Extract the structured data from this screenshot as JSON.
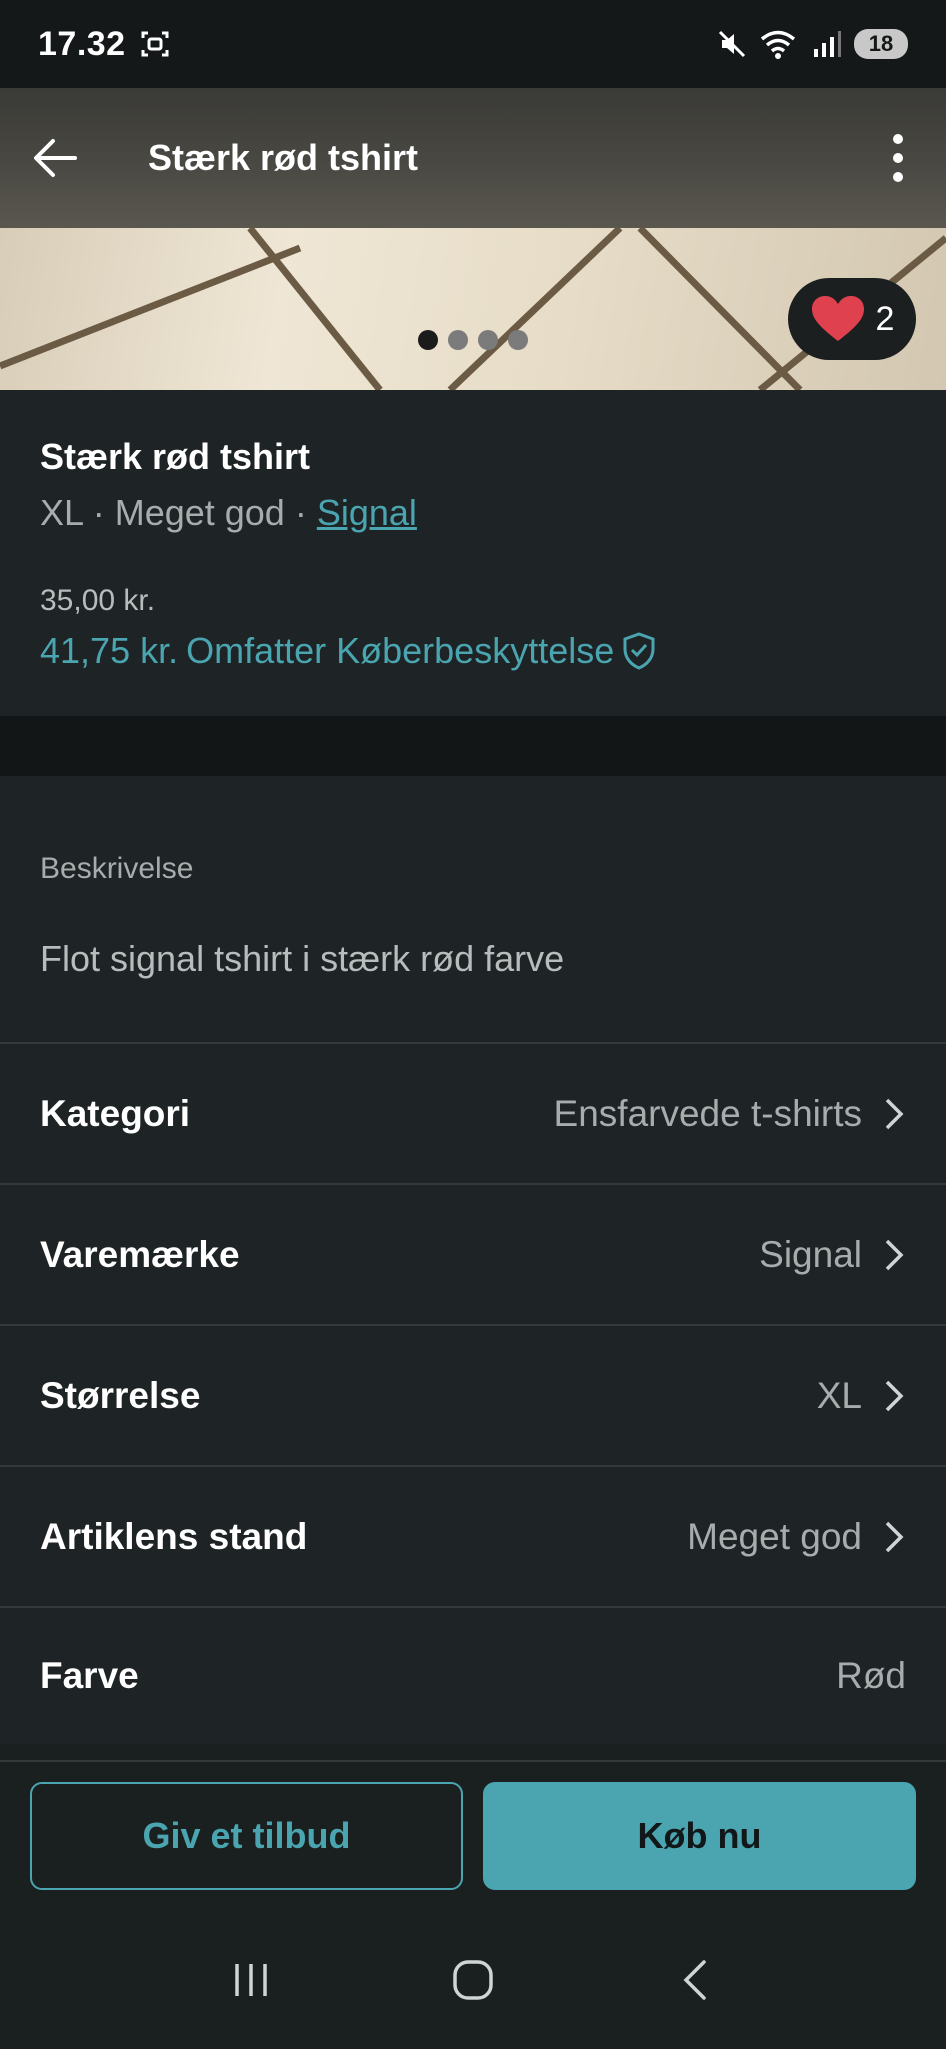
{
  "status_bar": {
    "time": "17.32",
    "battery": "18"
  },
  "app_bar": {
    "title": "Stærk rød tshirt"
  },
  "gallery": {
    "image_count": 4,
    "active_index": 0,
    "favorites_count": "2"
  },
  "item": {
    "title": "Stærk rød tshirt",
    "size": "XL",
    "separator": " · ",
    "condition": "Meget god",
    "brand": "Signal",
    "price": "35,00 kr.",
    "total_price": "41,75 kr.",
    "protection_text": "Omfatter Køberbeskyttelse"
  },
  "description": {
    "heading": "Beskrivelse",
    "text": "Flot signal tshirt i stærk rød farve"
  },
  "attributes": [
    {
      "label": "Kategori",
      "value": "Ensfarvede t-shirts"
    },
    {
      "label": "Varemærke",
      "value": "Signal"
    },
    {
      "label": "Størrelse",
      "value": "XL"
    },
    {
      "label": "Artiklens stand",
      "value": "Meget god"
    },
    {
      "label": "Farve",
      "value": "Rød"
    }
  ],
  "actions": {
    "offer_label": "Giv et tilbud",
    "buy_label": "Køb nu"
  },
  "colors": {
    "accent": "#4aa5b0",
    "background": "#1a1f20",
    "heart": "#e0414e"
  },
  "icons": {
    "back": "arrow-left-icon",
    "more": "more-vertical-icon",
    "favorite": "heart-icon",
    "protection": "shield-check-icon",
    "chevron": "chevron-right-icon"
  }
}
